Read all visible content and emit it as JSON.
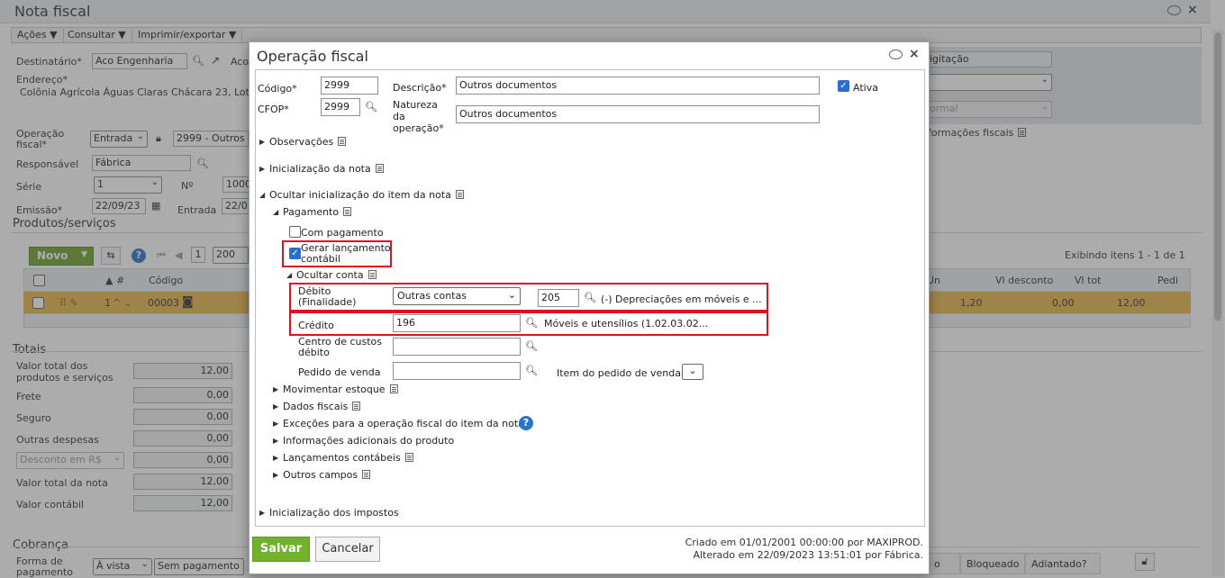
{
  "window": {
    "title": "Nota fiscal"
  },
  "menubar": {
    "items": [
      "Ações ▼",
      "Consultar ▼",
      "Imprimir/exportar ▼"
    ]
  },
  "header": {
    "destinatario_label": "Destinatário*",
    "destinatario_value": "Aco Engenharia",
    "destinatario_extra": "Aco",
    "endereco_label": "Endereço*",
    "endereco_value": "Colônia Agrícola Águas Claras Chácara 23, Lote",
    "operacao_label": "Operação fiscal*",
    "operacao_tipo": "Entrada",
    "operacao_value": "2999 - Outros",
    "responsavel_label": "Responsável",
    "responsavel_value": "Fábrica",
    "serie_label": "Série",
    "serie_value": "1",
    "no_label": "Nº",
    "no_value": "1000",
    "emissao_label": "Emissão*",
    "emissao_value": "22/09/23",
    "entrada_label": "Entrada",
    "entrada_value": "22/0",
    "digitacao_value": "igitação",
    "normal_value": "ormal",
    "info_fiscais_label": "formações fiscais"
  },
  "products": {
    "title": "Produtos/serviços",
    "novo_label": "Novo",
    "page_value": "1",
    "page_size": "200",
    "exibindo": "Exibindo itens 1 - 1 de 1",
    "col_num": "▲ #",
    "col_codigo": "Código",
    "col_un": "Un",
    "col_desconto": "Vl desconto",
    "col_tot": "Vl tot",
    "col_ped": "Pedi",
    "row_num": "1",
    "row_codigo": "00003",
    "row_un": "1,20",
    "row_desconto": "0,00",
    "row_tot": "12,00"
  },
  "totals": {
    "title": "Totais",
    "items": [
      {
        "label": "Valor total dos produtos e serviços",
        "value": "12,00"
      },
      {
        "label": "Frete",
        "value": "0,00"
      },
      {
        "label": "Seguro",
        "value": "0,00"
      },
      {
        "label": "Outras despesas",
        "value": "0,00"
      },
      {
        "label": "Desconto em R$",
        "value": "0,00"
      },
      {
        "label": "Valor total da nota",
        "value": "12,00"
      },
      {
        "label": "Valor contábil",
        "value": "12,00"
      }
    ]
  },
  "cobranca": {
    "title": "Cobrança",
    "forma_label": "Forma de pagamento",
    "forma_value": "À vista",
    "sem_pagamento": "Sem pagamento",
    "status_o": "o",
    "bloqueado": "Bloqueado",
    "adiantado": "Adiantado?"
  },
  "modal": {
    "title": "Operação fiscal",
    "codigo_label": "Código*",
    "codigo_value": "2999",
    "descricao_label": "Descrição*",
    "descricao_value": "Outros documentos",
    "ativa_label": "Ativa",
    "cfop_label": "CFOP*",
    "cfop_value": "2999",
    "natureza_label": "Natureza da operação*",
    "natureza_value": "Outros documentos",
    "observacoes": "Observações",
    "inicializacao_nota": "Inicialização da nota",
    "ocultar_item": "Ocultar inicialização do item da nota",
    "pagamento": "Pagamento",
    "com_pagamento": "Com pagamento",
    "gerar_lancamento": "Gerar lançamento contábil",
    "ocultar_conta": "Ocultar conta",
    "debito_label": "Débito (Finalidade)",
    "debito_tipo": "Outras contas",
    "debito_conta": "205",
    "debito_desc": "(-) Depreciações em móveis e ...",
    "credito_label": "Crédito",
    "credito_conta": "196",
    "credito_desc": "Móveis e utensílios (1.02.03.02...",
    "centro_custos_label": "Centro de custos débito",
    "pedido_venda_label": "Pedido de venda",
    "item_pedido_label": "Item do pedido de venda",
    "movimentar_estoque": "Movimentar estoque",
    "dados_fiscais": "Dados fiscais",
    "excecoes": "Exceções para a operação fiscal do item da nota",
    "info_adicionais": "Informações adicionais do produto",
    "lancamentos_contabeis": "Lançamentos contábeis",
    "outros_campos": "Outros campos",
    "inicializacao_impostos": "Inicialização dos impostos",
    "salvar": "Salvar",
    "cancelar": "Cancelar",
    "criado_em": "Criado em 01/01/2001 00:00:00 por MAXIPROD.",
    "alterado_em": "Alterado em 22/09/2023 13:51:01 por Fábrica."
  }
}
